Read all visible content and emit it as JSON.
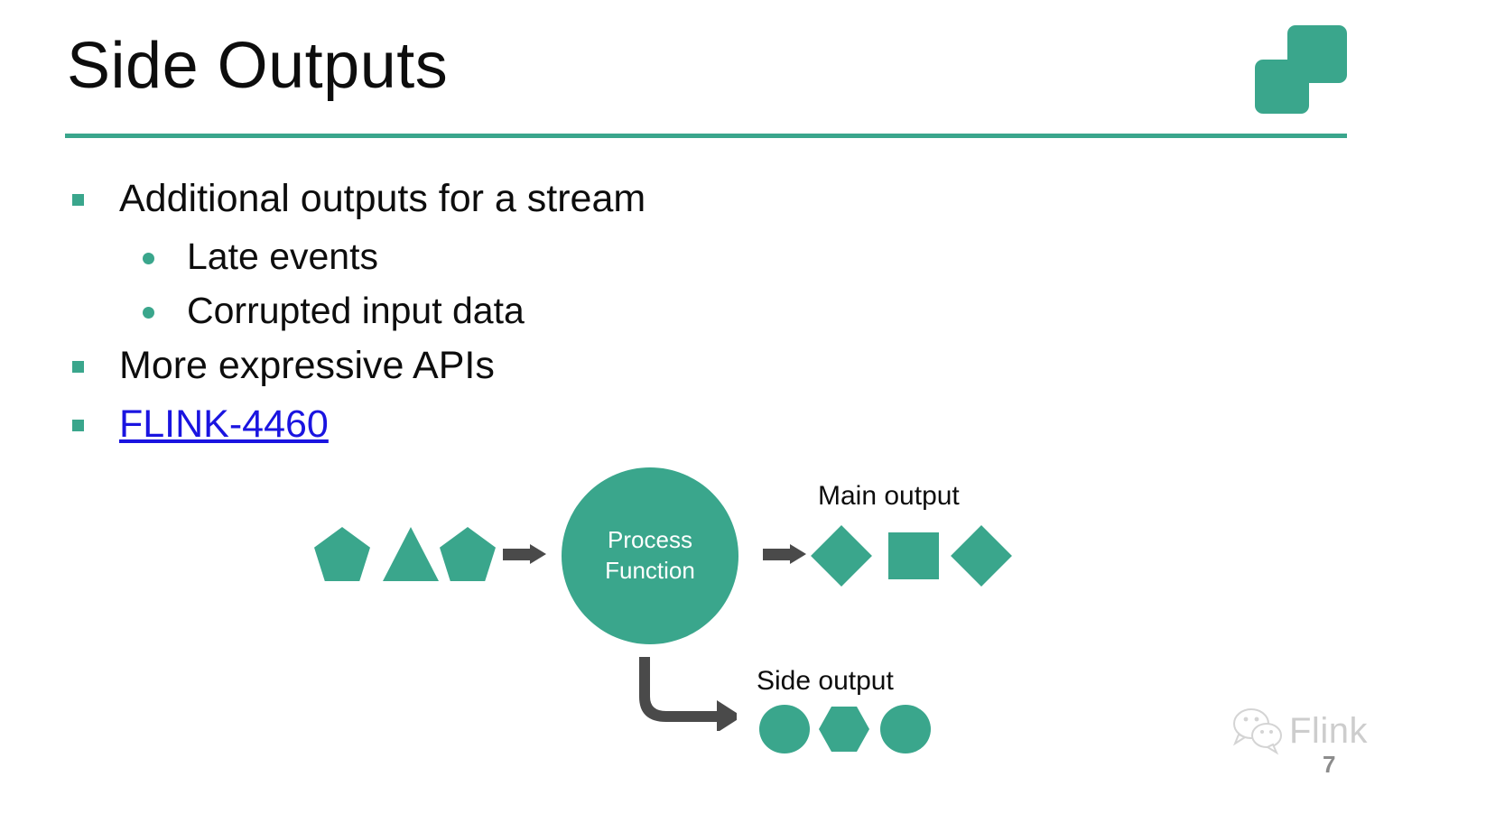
{
  "slide": {
    "title": "Side Outputs",
    "page_number": "7",
    "accent_color": "#3aa68c",
    "arrow_color": "#4a4a4a",
    "link_color": "#1a14e0"
  },
  "logo": {
    "name": "flink-squares-logo"
  },
  "bullets": [
    {
      "level": 1,
      "marker": "square",
      "text": "Additional outputs for a stream"
    },
    {
      "level": 2,
      "marker": "dot",
      "text": "Late events"
    },
    {
      "level": 2,
      "marker": "dot",
      "text": "Corrupted input data"
    },
    {
      "level": 1,
      "marker": "square",
      "text": "More expressive APIs"
    },
    {
      "level": 1,
      "marker": "square",
      "text": "FLINK-4460",
      "is_link": true
    }
  ],
  "diagram": {
    "input_shapes": [
      "pentagon",
      "triangle",
      "pentagon"
    ],
    "process": {
      "line1": "Process",
      "line2": "Function"
    },
    "main_output": {
      "label": "Main output",
      "shapes": [
        "diamond",
        "square",
        "diamond"
      ]
    },
    "side_output": {
      "label": "Side output",
      "shapes": [
        "circle",
        "hexagon",
        "circle"
      ]
    },
    "arrows": [
      "input-arrow",
      "main-output-arrow",
      "side-output-elbow-arrow"
    ]
  },
  "watermark": {
    "text": "Flink",
    "icon": "wechat-icon"
  }
}
